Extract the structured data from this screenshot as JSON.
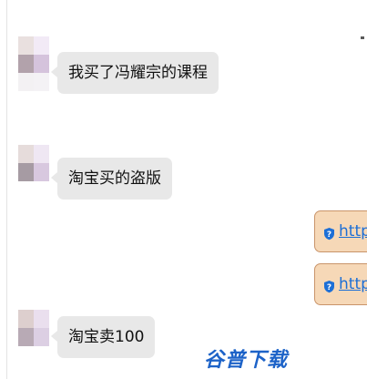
{
  "messages": [
    {
      "side": "left",
      "text": "我买了冯耀宗的课程"
    },
    {
      "side": "left",
      "text": "淘宝买的盗版"
    },
    {
      "side": "right",
      "link_text": "http",
      "icon": "shield-question-icon"
    },
    {
      "side": "right",
      "link_text": "http",
      "icon": "shield-question-icon"
    },
    {
      "side": "left",
      "text": "淘宝卖100"
    }
  ],
  "watermark": {
    "text": "谷普下载"
  },
  "colors": {
    "left_bubble": "#e8e8e8",
    "right_bubble": "#f6d8b7",
    "right_bubble_border": "#c9946a",
    "link": "#1d6fd6",
    "watermark": "#1d63c8"
  }
}
